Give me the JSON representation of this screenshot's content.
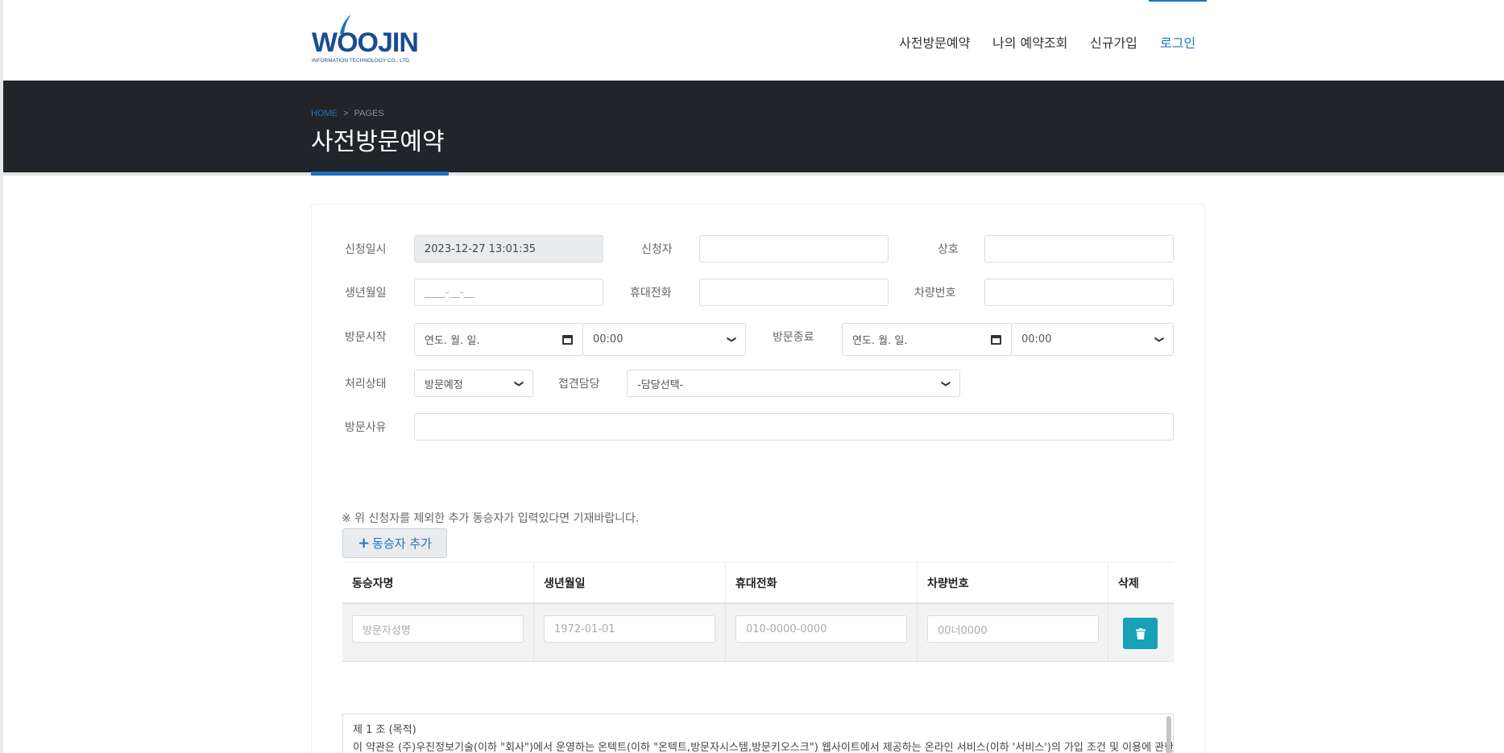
{
  "brand": {
    "logo_text": "WOOJIN",
    "logo_sub": "INFORMATION TECHNOLOGY CO., LTD."
  },
  "nav": {
    "items": [
      {
        "label": "사전방문예약"
      },
      {
        "label": "나의 예약조회"
      },
      {
        "label": "신규가입"
      },
      {
        "label": "로그인"
      }
    ]
  },
  "page_header": {
    "crumb_home": "HOME",
    "crumb_sep": ">",
    "crumb_current": "PAGES",
    "title": "사전방문예약"
  },
  "form": {
    "request_datetime": {
      "label": "신청일시",
      "value": "2023-12-27 13:01:35"
    },
    "applicant": {
      "label": "신청자",
      "value": ""
    },
    "company": {
      "label": "상호",
      "value": ""
    },
    "birthdate": {
      "label": "생년월일",
      "placeholder": "____-__-__"
    },
    "mobile": {
      "label": "휴대전화",
      "value": ""
    },
    "car_number": {
      "label": "차량번호",
      "value": ""
    },
    "visit_start": {
      "label": "방문시작",
      "date_placeholder": "연도. 월. 일.",
      "time": "00:00"
    },
    "visit_end": {
      "label": "방문종료",
      "date_placeholder": "연도. 월. 일.",
      "time": "00:00"
    },
    "status": {
      "label": "처리상태",
      "selected": "방문예정"
    },
    "contact": {
      "label": "접견담당",
      "selected": "-담당선택-"
    },
    "reason": {
      "label": "방문사유",
      "value": ""
    }
  },
  "companions": {
    "note": "※ 위 신청자를 제외한 추가 동승자가 입력있다면 기재바랍니다.",
    "add_button": "동승자 추가",
    "columns": [
      "동승자명",
      "생년월일",
      "휴대전화",
      "차량번호",
      "삭제"
    ],
    "row_placeholders": [
      "방문자성명",
      "1972-01-01",
      "010-0000-0000",
      "00너0000"
    ]
  },
  "terms": {
    "title": "제 1 조 (목적)",
    "body": "이 약관은 (주)우진정보기술(이하 \"회사\")에서 운영하는 온텍트(이하 \"온텍트,방문자시스템,방문키오스크\") 웹사이트에서 제공하는 온라인 서비스(이하 '서비스')의 가입 조건 및 이용에 관한 제"
  },
  "colors": {
    "accent": "#1e73be",
    "dark_header": "#212529",
    "delete_button": "#17a2b8"
  },
  "icons": {
    "add": "plus-icon",
    "delete": "trash-icon",
    "dropdown": "chevron-down-icon",
    "date": "calendar-icon"
  }
}
